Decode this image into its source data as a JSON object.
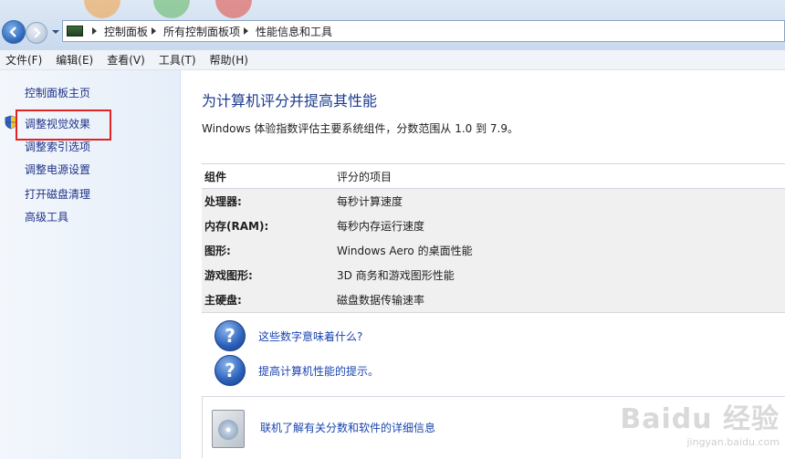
{
  "breadcrumb": [
    "控制面板",
    "所有控制面板项",
    "性能信息和工具"
  ],
  "menu": [
    "文件(F)",
    "编辑(E)",
    "查看(V)",
    "工具(T)",
    "帮助(H)"
  ],
  "sidebar": {
    "home": "控制面板主页",
    "links": [
      "调整视觉效果",
      "调整索引选项",
      "调整电源设置",
      "打开磁盘清理",
      "高级工具"
    ]
  },
  "main": {
    "heading": "为计算机评分并提高其性能",
    "description": "Windows 体验指数评估主要系统组件，分数范围从 1.0 到 7.9。",
    "table": {
      "headers": [
        "组件",
        "评分的项目"
      ],
      "rows": [
        [
          "处理器:",
          "每秒计算速度"
        ],
        [
          "内存(RAM):",
          "每秒内存运行速度"
        ],
        [
          "图形:",
          "Windows Aero 的桌面性能"
        ],
        [
          "游戏图形:",
          "3D 商务和游戏图形性能"
        ],
        [
          "主硬盘:",
          "磁盘数据传输速率"
        ]
      ]
    },
    "help_links": [
      "这些数字意味着什么?",
      "提高计算机性能的提示。"
    ],
    "online_link": "联机了解有关分数和软件的详细信息"
  },
  "watermark": {
    "main": "Baidu 经验",
    "sub": "jingyan.baidu.com"
  },
  "colors": {
    "link": "#1e3287",
    "heading": "#1a3b8e",
    "highlight": "#e02424"
  }
}
